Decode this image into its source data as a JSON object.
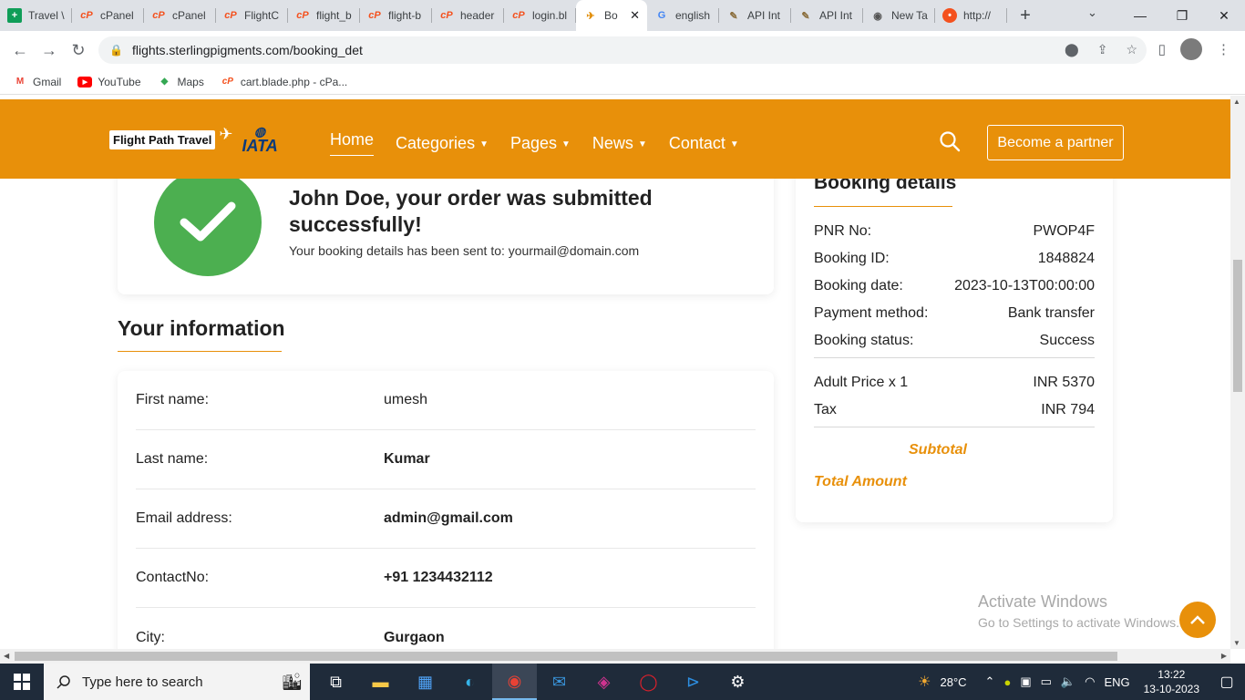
{
  "browser": {
    "tabs": [
      {
        "label": "Travel \\",
        "icon": "sheets"
      },
      {
        "label": "cPanel",
        "icon": "cpanel"
      },
      {
        "label": "cPanel",
        "icon": "cpanel"
      },
      {
        "label": "FlightC",
        "icon": "cpanel"
      },
      {
        "label": "flight_b",
        "icon": "cpanel"
      },
      {
        "label": "flight-b",
        "icon": "cpanel"
      },
      {
        "label": "header",
        "icon": "cpanel"
      },
      {
        "label": "login.bl",
        "icon": "cpanel"
      },
      {
        "label": "Bo",
        "icon": "flightpath",
        "active": true
      },
      {
        "label": "english",
        "icon": "google"
      },
      {
        "label": "API Int",
        "icon": "feather"
      },
      {
        "label": "API Int",
        "icon": "feather"
      },
      {
        "label": "New Ta",
        "icon": "chrome"
      },
      {
        "label": "http://",
        "icon": "orange"
      }
    ],
    "url": "flights.sterlingpigments.com/booking_det",
    "bookmarks": [
      "Gmail",
      "YouTube",
      "Maps",
      "cart.blade.php - cPa..."
    ]
  },
  "site": {
    "logo_text": "Flight Path Travel",
    "logo_iata": "IATA",
    "menu": {
      "home": "Home",
      "categories": "Categories",
      "pages": "Pages",
      "news": "News",
      "contact": "Contact"
    },
    "partner_button": "Become a partner",
    "accent": "#e8900a"
  },
  "success": {
    "title": "John Doe, your order was submitted successfully!",
    "subtitle": "Your booking details has been sent to: yourmail@domain.com"
  },
  "your_info": {
    "heading": "Your information",
    "rows": [
      {
        "label": "First name:",
        "value": "umesh"
      },
      {
        "label": "Last name:",
        "value": "Kumar"
      },
      {
        "label": "Email address:",
        "value": "admin@gmail.com"
      },
      {
        "label": "ContactNo:",
        "value": "+91 1234432112"
      },
      {
        "label": "City:",
        "value": "Gurgaon"
      }
    ]
  },
  "booking": {
    "heading": "Booking details",
    "rows": [
      {
        "label": "PNR No:",
        "value": "PWOP4F"
      },
      {
        "label": "Booking ID:",
        "value": "1848824"
      },
      {
        "label": "Booking date:",
        "value": "2023-10-13T00:00:00"
      },
      {
        "label": "Payment method:",
        "value": "Bank transfer"
      },
      {
        "label": "Booking status:",
        "value": "Success"
      }
    ],
    "prices": [
      {
        "label": "Adult Price x 1",
        "value": "INR 5370"
      },
      {
        "label": "Tax",
        "value": "INR 794"
      }
    ],
    "subtotal_label": "Subtotal",
    "total_label": "Total Amount"
  },
  "watermark": {
    "line1": "Activate Windows",
    "line2": "Go to Settings to activate Windows."
  },
  "taskbar": {
    "search_placeholder": "Type here to search",
    "weather": "28°C",
    "language": "ENG",
    "time": "13:22",
    "date": "13-10-2023"
  }
}
